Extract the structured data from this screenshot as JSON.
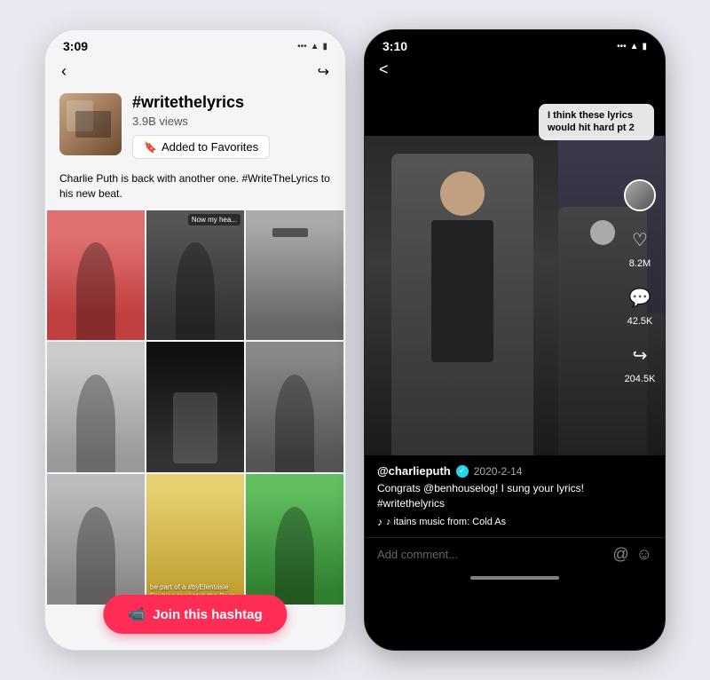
{
  "left_phone": {
    "status_time": "3:09",
    "status_dots": "...",
    "hashtag_title": "#writethelyrics",
    "hashtag_views": "3.9B views",
    "favorites_btn": "Added to Favorites",
    "description": "Charlie Puth is back with another one. #WriteTheLyrics to his new beat.",
    "join_btn": "Join this hashtag",
    "grid_overlay": [
      "",
      "Now my hea...",
      "",
      "",
      "",
      "",
      "",
      "be part of a #byElentasie Fashion to sketch the Beat",
      ""
    ]
  },
  "right_phone": {
    "status_time": "3:10",
    "status_dots": "...",
    "video_overlay": "I think these lyrics would hit hard pt 2",
    "username": "@charlieputh",
    "date": "2020-2-14",
    "description": "Congrats @benhouselog! I sung your lyrics! #writethelyrics",
    "music": "♪ itains music from: Cold As",
    "likes_count": "8.2M",
    "comments_count": "42.5K",
    "shares_count": "204.5K",
    "comment_placeholder": "Add comment...",
    "back_label": "<"
  }
}
